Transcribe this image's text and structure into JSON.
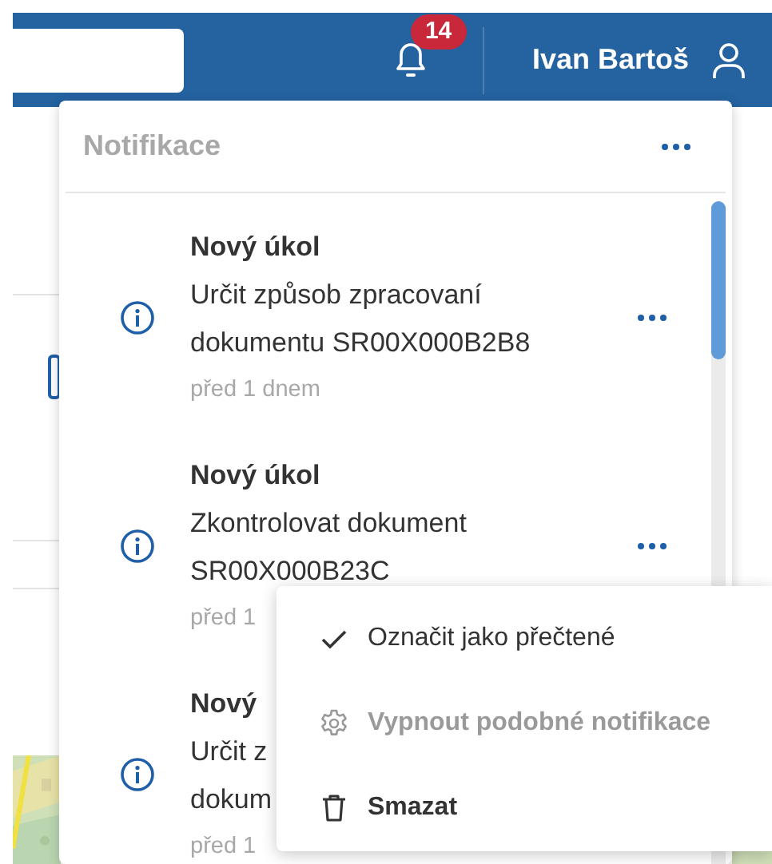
{
  "header": {
    "notification_count": "14",
    "user_name": "Ivan Bartoš"
  },
  "notifications": {
    "title": "Notifikace",
    "items": [
      {
        "title": "Nový úkol",
        "lines": [
          "Určit způsob zpracovaní",
          "dokumentu SR00X000B2B8"
        ],
        "time": "před 1 dnem",
        "more_button": true
      },
      {
        "title": "Nový úkol",
        "lines": [
          "Zkontrolovat dokument",
          "SR00X000B23C"
        ],
        "time": "před 1",
        "more_button": true
      },
      {
        "title": "Nový",
        "lines": [
          "Určit z",
          "dokum"
        ],
        "time": "před 1",
        "more_button": false
      }
    ]
  },
  "context_menu": [
    {
      "kind": "check",
      "label": "Označit jako přečtené",
      "disabled": false,
      "hovered": false
    },
    {
      "kind": "settings",
      "label": "Vypnout podobné notifikace",
      "disabled": true,
      "hovered": false
    },
    {
      "kind": "delete",
      "label": "Smazat",
      "disabled": false,
      "hovered": true
    }
  ]
}
